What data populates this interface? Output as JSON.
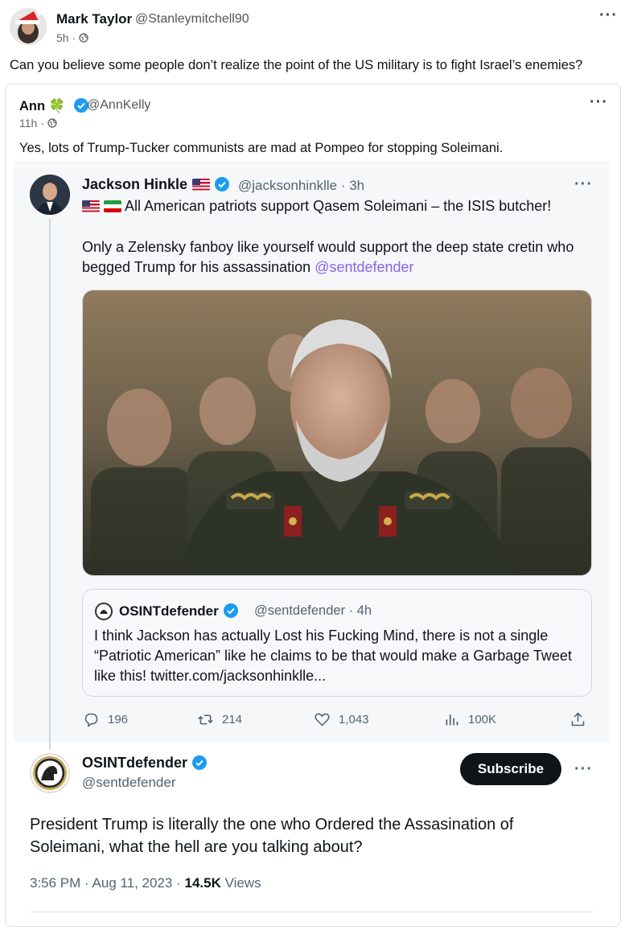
{
  "post1": {
    "name": "Mark Taylor",
    "handle": "@Stanleymitchell90",
    "time": "5h",
    "text": "Can you believe some people don’t realize the point of the US military is to fight Israel’s enemies?"
  },
  "post2": {
    "name": "Ann",
    "emoji": "🍀",
    "handle": "@AnnKelly",
    "time": "11h",
    "text": "Yes, lots of Trump-Tucker communists are mad at Pompeo for stopping Soleimani."
  },
  "tweet": {
    "name": "Jackson Hinkle",
    "handle": "@jacksonhinklle",
    "time": "3h",
    "line1": "All American patriots support Qasem Soleimani – the ISIS butcher!",
    "line2": "Only a Zelensky fanboy like yourself would support the deep state cretin who begged Trump for his assassination",
    "mention": "@sentdefender",
    "quote": {
      "name": "OSINTdefender",
      "handle": "@sentdefender",
      "time": "4h",
      "text": "I think Jackson has actually Lost his Fucking Mind, there is not a single “Patriotic American” like he claims to be that would make a Garbage Tweet like this! twitter.com/jacksonhinklle..."
    },
    "stats": {
      "replies": "196",
      "retweets": "214",
      "likes": "1,043",
      "views": "100K"
    }
  },
  "reply": {
    "name": "OSINTdefender",
    "handle": "@sentdefender",
    "subscribe_label": "Subscribe",
    "text": "President Trump is literally the one who Ordered the Assasination of Soleimani, what the hell are you talking about?",
    "timestamp": "3:56 PM · Aug 11, 2023 ·",
    "views_count": "14.5K",
    "views_label": "Views"
  },
  "colors": {
    "verified": "#1d9bf0",
    "mention": "#8a63e8",
    "subscribe_bg": "#0f1419"
  }
}
